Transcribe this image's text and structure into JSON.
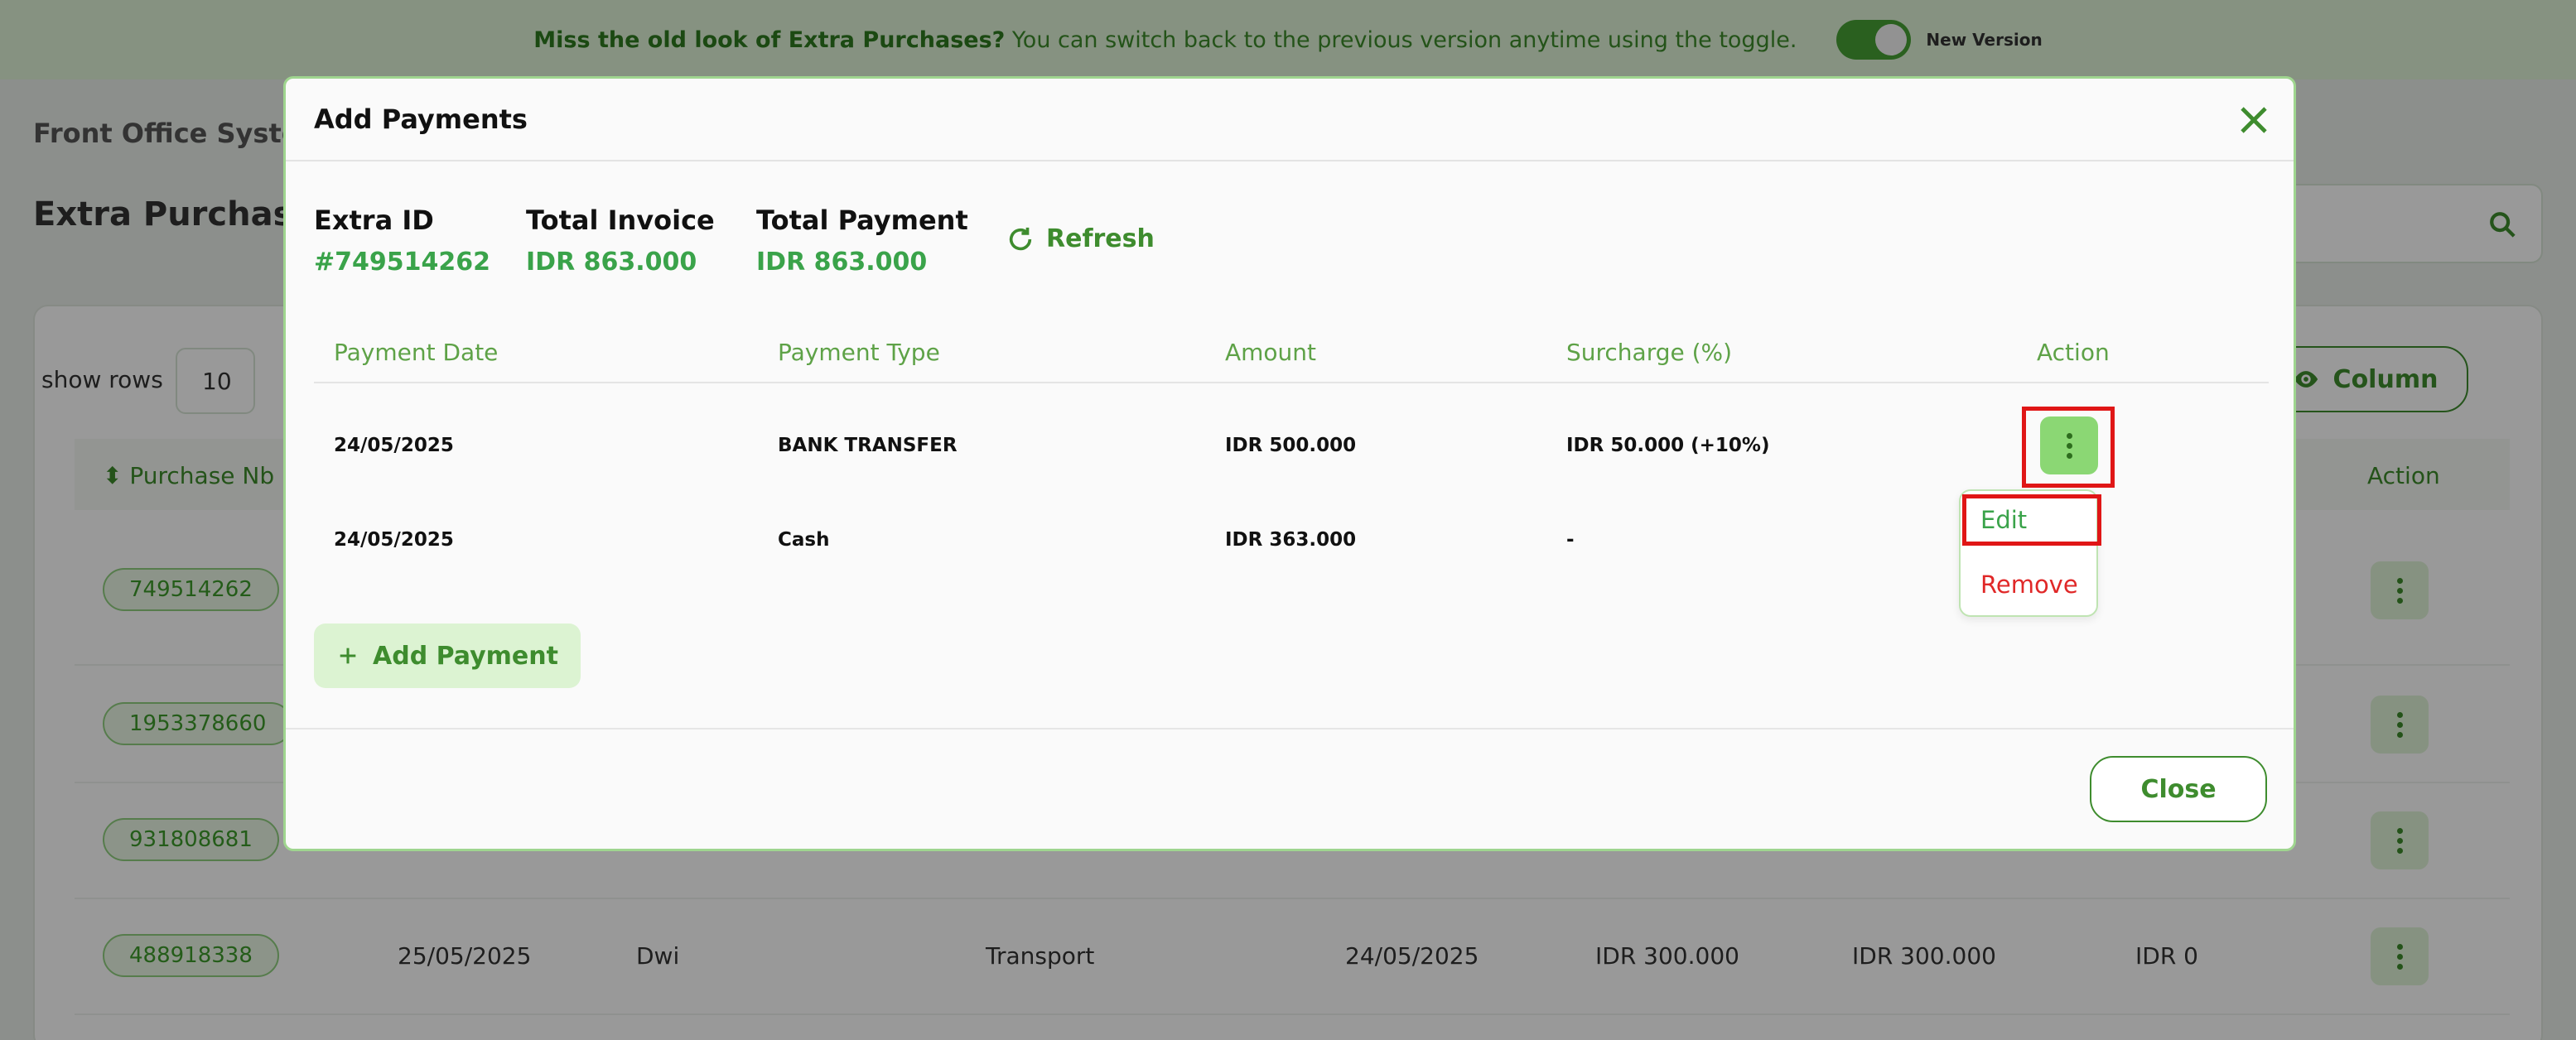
{
  "banner": {
    "bold_text": "Miss the old look of Extra Purchases?",
    "text": " You can switch back to the previous version anytime using the toggle.",
    "toggle_label": "New Version"
  },
  "background": {
    "system_title": "Front Office Syster",
    "page_title": "Extra Purchases",
    "show_rows_label": "show rows",
    "rows_value": "10",
    "column_button": "Column",
    "header_purchase": "Purchase Nb",
    "header_action": "Action",
    "purchase_numbers": [
      "749514262",
      "1953378660",
      "931808681",
      "488918338"
    ],
    "last_row": {
      "date1": "25/05/2025",
      "name": "Dwi",
      "type": "Transport",
      "date2": "24/05/2025",
      "amount1": "IDR 300.000",
      "amount2": "IDR 300.000",
      "amount3": "IDR 0"
    }
  },
  "modal": {
    "title": "Add Payments",
    "extra_id_label": "Extra ID",
    "extra_id_value": "#749514262",
    "total_invoice_label": "Total Invoice",
    "total_invoice_value": "IDR 863.000",
    "total_payment_label": "Total Payment",
    "total_payment_value": "IDR 863.000",
    "refresh_label": "Refresh",
    "columns": [
      "Payment Date",
      "Payment Type",
      "Amount",
      "Surcharge (%)",
      "Action"
    ],
    "rows": [
      {
        "date": "24/05/2025",
        "type": "BANK TRANSFER",
        "amount": "IDR 500.000",
        "surcharge": "IDR 50.000 (+10%)"
      },
      {
        "date": "24/05/2025",
        "type": "Cash",
        "amount": "IDR 363.000",
        "surcharge": "-"
      }
    ],
    "dropdown": {
      "edit": "Edit",
      "remove": "Remove"
    },
    "add_payment_label": "Add Payment",
    "close_label": "Close"
  },
  "colors": {
    "accent": "#3e8c2e",
    "highlight": "#e01616",
    "remove": "#e02828"
  }
}
